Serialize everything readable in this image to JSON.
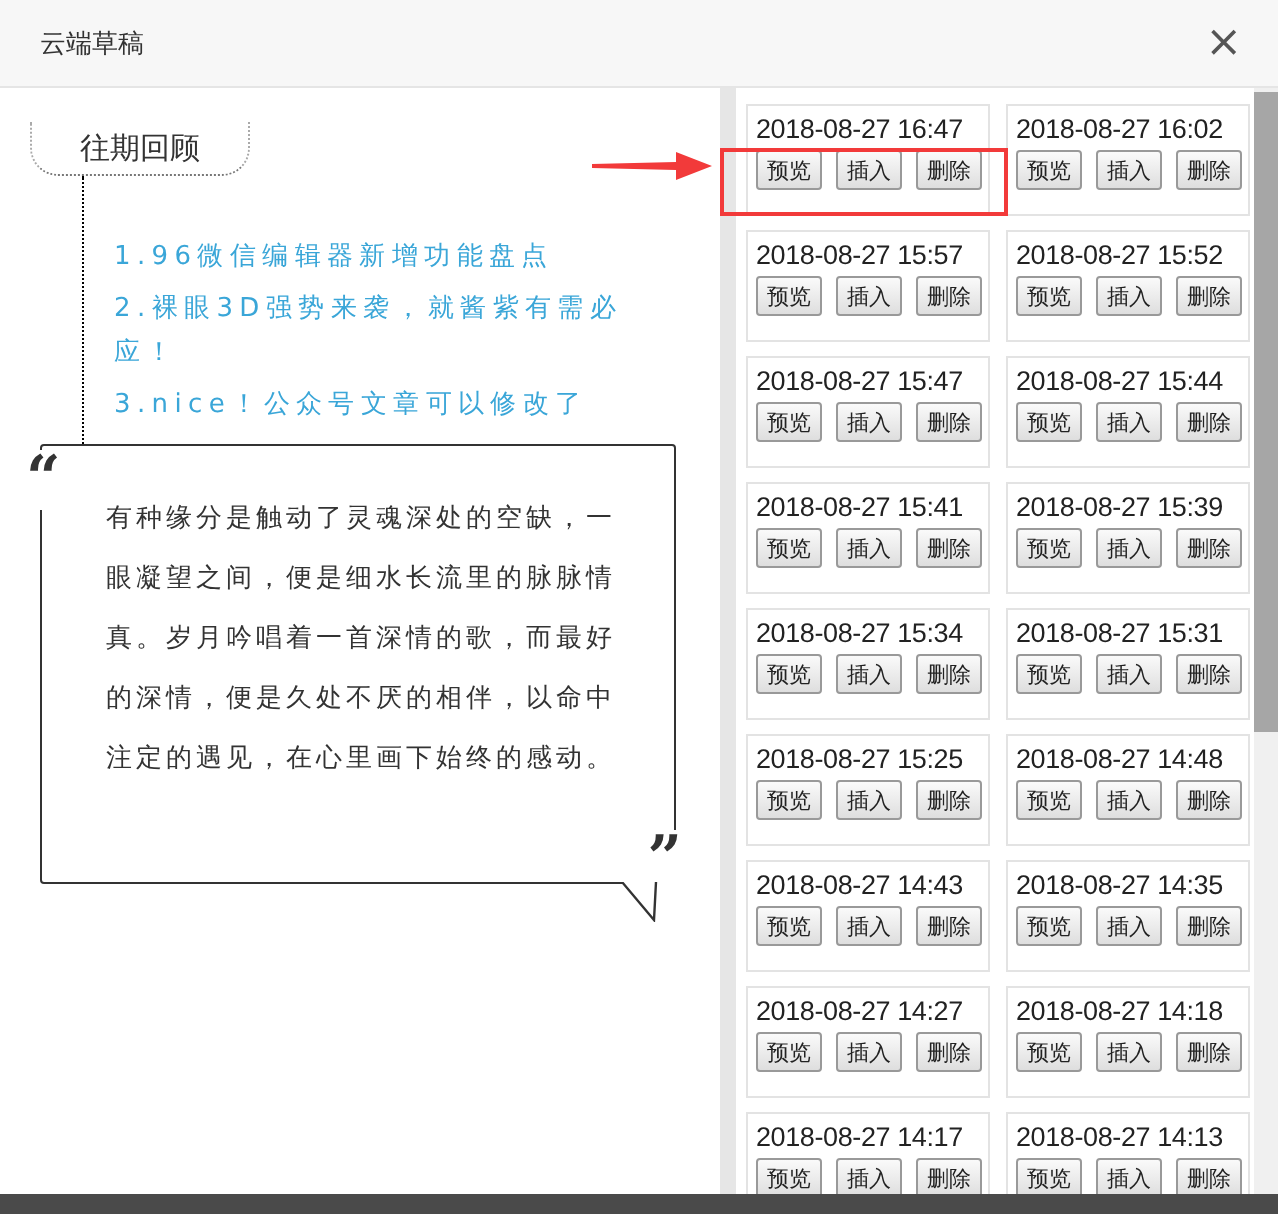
{
  "window": {
    "title": "云端草稿",
    "close": "×"
  },
  "section_tab": "往期回顾",
  "links": [
    "1.96微信编辑器新增功能盘点",
    "2.裸眼3D强势来袭，就酱紫有需必应！",
    "3.nice！公众号文章可以修改了"
  ],
  "quote": {
    "open_mark": "“",
    "close_mark": "”",
    "text": "有种缘分是触动了灵魂深处的空缺，一眼凝望之间，便是细水长流里的脉脉情真。岁月吟唱着一首深情的歌，而最好的深情，便是久处不厌的相伴，以命中注定的遇见，在心里画下始终的感动。"
  },
  "drafts": [
    {
      "date": "2018-08-27 16:47",
      "actions": [
        "预览",
        "插入",
        "删除"
      ]
    },
    {
      "date": "2018-08-27 16:02",
      "actions": [
        "预览",
        "插入",
        "删除"
      ]
    },
    {
      "date": "2018-08-27 15:57",
      "actions": [
        "预览",
        "插入",
        "删除"
      ]
    },
    {
      "date": "2018-08-27 15:52",
      "actions": [
        "预览",
        "插入",
        "删除"
      ]
    },
    {
      "date": "2018-08-27 15:47",
      "actions": [
        "预览",
        "插入",
        "删除"
      ]
    },
    {
      "date": "2018-08-27 15:44",
      "actions": [
        "预览",
        "插入",
        "删除"
      ]
    },
    {
      "date": "2018-08-27 15:41",
      "actions": [
        "预览",
        "插入",
        "删除"
      ]
    },
    {
      "date": "2018-08-27 15:39",
      "actions": [
        "预览",
        "插入",
        "删除"
      ]
    },
    {
      "date": "2018-08-27 15:34",
      "actions": [
        "预览",
        "插入",
        "删除"
      ]
    },
    {
      "date": "2018-08-27 15:31",
      "actions": [
        "预览",
        "插入",
        "删除"
      ]
    },
    {
      "date": "2018-08-27 15:25",
      "actions": [
        "预览",
        "插入",
        "删除"
      ]
    },
    {
      "date": "2018-08-27 14:48",
      "actions": [
        "预览",
        "插入",
        "删除"
      ]
    },
    {
      "date": "2018-08-27 14:43",
      "actions": [
        "预览",
        "插入",
        "删除"
      ]
    },
    {
      "date": "2018-08-27 14:35",
      "actions": [
        "预览",
        "插入",
        "删除"
      ]
    },
    {
      "date": "2018-08-27 14:27",
      "actions": [
        "预览",
        "插入",
        "删除"
      ]
    },
    {
      "date": "2018-08-27 14:18",
      "actions": [
        "预览",
        "插入",
        "删除"
      ]
    },
    {
      "date": "2018-08-27 14:17",
      "actions": [
        "预览",
        "插入",
        "删除"
      ]
    },
    {
      "date": "2018-08-27 14:13",
      "actions": [
        "预览",
        "插入",
        "删除"
      ]
    }
  ]
}
